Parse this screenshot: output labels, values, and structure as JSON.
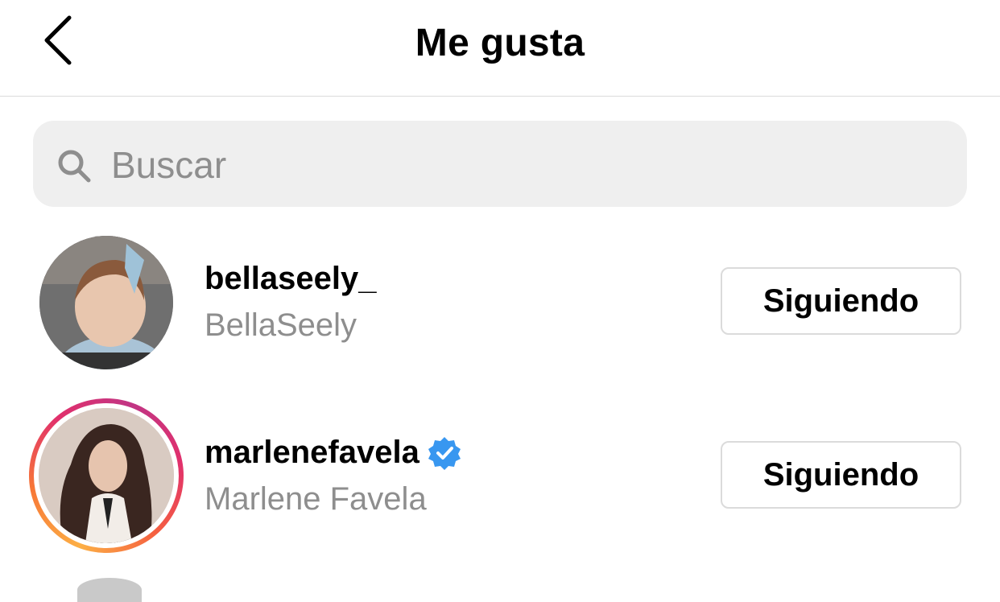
{
  "header": {
    "title": "Me gusta"
  },
  "search": {
    "placeholder": "Buscar",
    "value": ""
  },
  "likes": [
    {
      "username": "bellaseely_",
      "full_name": "BellaSeely",
      "button_label": "Siguiendo",
      "verified": false,
      "story_ring": false
    },
    {
      "username": "marlenefavela",
      "full_name": "Marlene Favela",
      "button_label": "Siguiendo",
      "verified": true,
      "story_ring": true
    }
  ],
  "colors": {
    "verified_blue": "#3897f0",
    "secondary_text": "#8e8e8e",
    "search_bg": "#efefef",
    "border": "#dbdbdb"
  },
  "icons": {
    "back": "chevron-left-icon",
    "search": "search-icon",
    "verified": "verified-badge-icon"
  }
}
